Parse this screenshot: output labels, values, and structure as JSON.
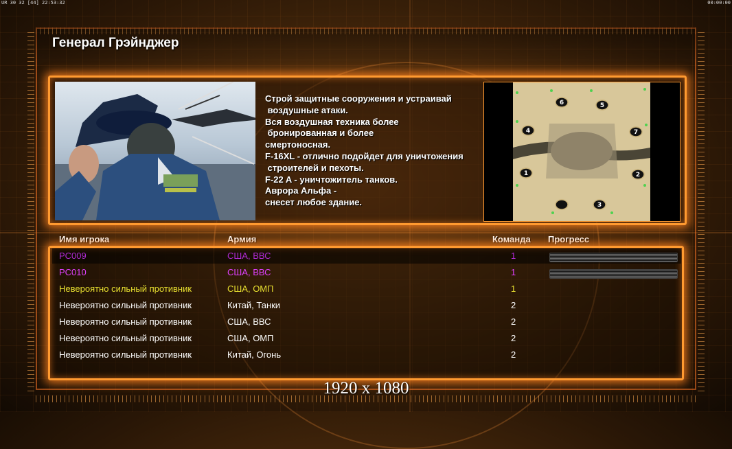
{
  "topbar": {
    "left": "UR 30 32 [44] 22:53:32",
    "right": "00:00:00"
  },
  "general": {
    "title": "Генерал Грэйнджер"
  },
  "description": [
    "Строй защитные сооружения и устраивай",
    " воздушные атаки.",
    "Вся воздушная техника более",
    " бронированная и более",
    "смертоносная.",
    "F-16XL - отлично подойдет для уничтожения",
    " строителей и пехоты.",
    "F-22 A - уничтожитель танков.",
    "Аврора Альфа -",
    "снесет любое здание."
  ],
  "map": {
    "slots": [
      "6",
      "5",
      "4",
      "7",
      "1",
      "2",
      "3"
    ]
  },
  "table": {
    "headers": {
      "name": "Имя игрока",
      "army": "Армия",
      "team": "Команда",
      "progress": "Прогресс"
    },
    "rows": [
      {
        "name": "PC009",
        "army": "США, ВВС",
        "team": "1",
        "color": "#b02ad4",
        "progress": true
      },
      {
        "name": "PC010",
        "army": "США, ВВС",
        "team": "1",
        "color": "#e040ff",
        "progress": true
      },
      {
        "name": "Невероятно сильный противник",
        "army": "США, ОМП",
        "team": "1",
        "color": "#e8e030",
        "progress": false
      },
      {
        "name": "Невероятно сильный противник",
        "army": "Китай, Танки",
        "team": "2",
        "color": "#ffffff",
        "progress": false
      },
      {
        "name": "Невероятно сильный противник",
        "army": "США, ВВС",
        "team": "2",
        "color": "#ffffff",
        "progress": false
      },
      {
        "name": "Невероятно сильный противник",
        "army": "США, ОМП",
        "team": "2",
        "color": "#ffffff",
        "progress": false
      },
      {
        "name": "Невероятно сильный противник",
        "army": "Китай, Огонь",
        "team": "2",
        "color": "#ffffff",
        "progress": false
      }
    ]
  },
  "resolution": "1920 x 1080"
}
